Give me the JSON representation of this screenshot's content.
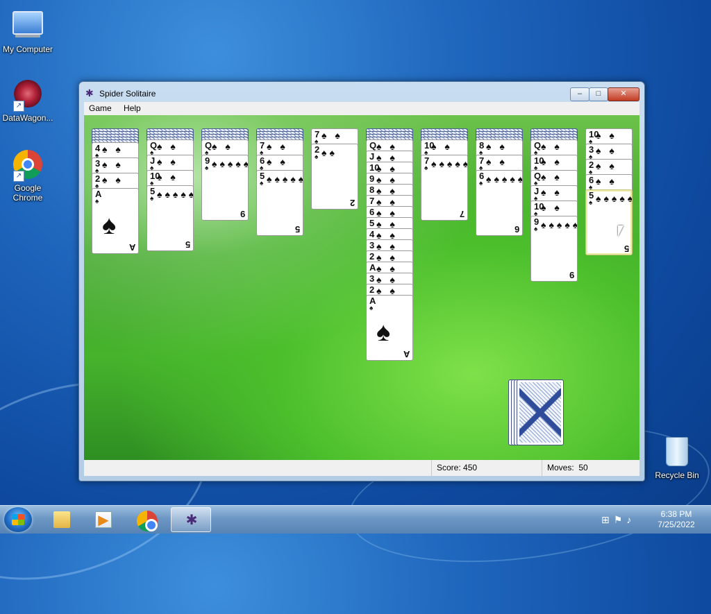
{
  "desktop": {
    "icons": [
      {
        "label": "My Computer",
        "icon": "computer-icon"
      },
      {
        "label": "DataWagon...",
        "icon": "datawagon-icon"
      },
      {
        "label": "Google Chrome",
        "icon": "chrome-icon"
      },
      {
        "label": "Recycle Bin",
        "icon": "recycle-bin-icon"
      }
    ]
  },
  "window": {
    "title": "Spider Solitaire",
    "controls": {
      "minimize": "–",
      "maximize": "□",
      "close": "✕"
    },
    "menu": [
      "Game",
      "Help"
    ]
  },
  "status": {
    "score_label": "Score:",
    "score": "450",
    "moves_label": "Moves:",
    "moves": "50"
  },
  "game": {
    "suit": "♠",
    "columns": [
      {
        "hidden": 5,
        "cards": [
          "4",
          "3",
          "2",
          "A"
        ]
      },
      {
        "hidden": 4,
        "cards": [
          "Q",
          "J",
          "10",
          "5"
        ]
      },
      {
        "hidden": 4,
        "cards": [
          "Q",
          "9"
        ]
      },
      {
        "hidden": 4,
        "cards": [
          "7",
          "6",
          "5"
        ]
      },
      {
        "hidden": 0,
        "cards": [
          "7",
          "2"
        ]
      },
      {
        "hidden": 4,
        "cards": [
          "Q",
          "J",
          "10",
          "9",
          "8",
          "7",
          "6",
          "5",
          "4",
          "3",
          "2",
          "A",
          "3",
          "2",
          "A"
        ]
      },
      {
        "hidden": 4,
        "cards": [
          "10",
          "7"
        ]
      },
      {
        "hidden": 4,
        "cards": [
          "8",
          "7",
          "6"
        ]
      },
      {
        "hidden": 4,
        "cards": [
          "Q",
          "10",
          "Q",
          "J",
          "10",
          "9"
        ]
      },
      {
        "hidden": 0,
        "cards": [
          "10",
          "3",
          "2",
          "6",
          "5"
        ]
      }
    ],
    "stock_piles": 4
  },
  "taskbar": {
    "items": [
      {
        "name": "explorer",
        "icon": "folder-icon"
      },
      {
        "name": "media-player",
        "icon": "media-player-icon"
      },
      {
        "name": "chrome",
        "icon": "chrome-icon"
      },
      {
        "name": "spider-solitaire",
        "icon": "spider-icon",
        "active": true
      }
    ],
    "clock": {
      "time": "6:38 PM",
      "date": "7/25/2022"
    }
  }
}
